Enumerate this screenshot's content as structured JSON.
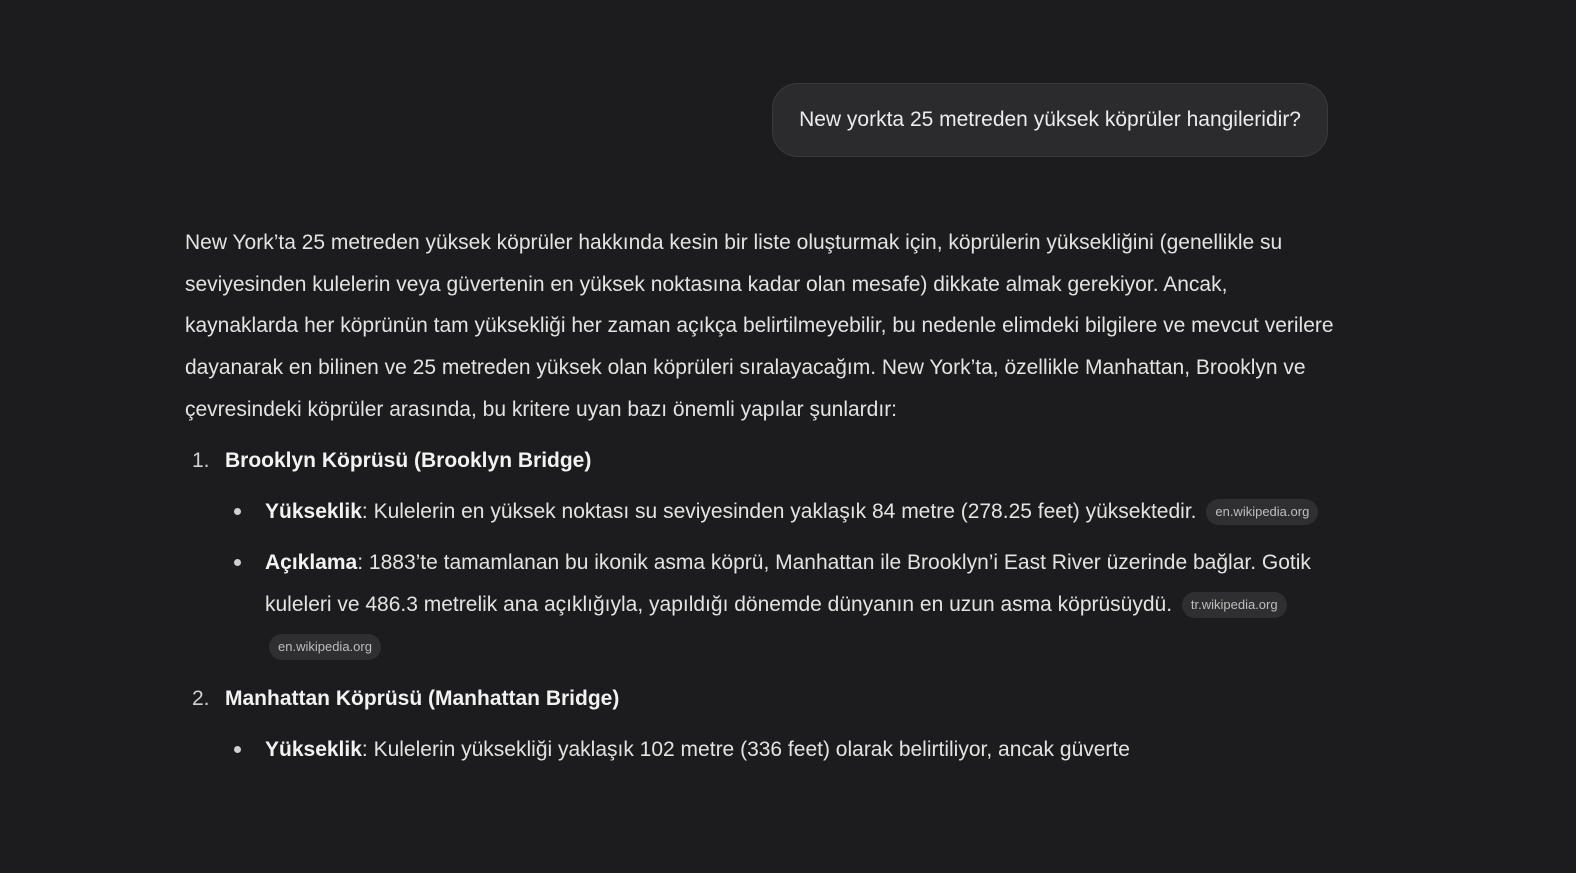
{
  "user_message": "New yorkta 25 metreden yüksek köprüler hangileridir?",
  "answer": {
    "intro": "New York’ta 25 metreden yüksek köprüler hakkında kesin bir liste oluşturmak için, köprülerin yüksekliğini (genellikle su seviyesinden kulelerin veya güvertenin en yüksek noktasına kadar olan mesafe) dikkate almak gerekiyor. Ancak, kaynaklarda her köprünün tam yüksekliği her zaman açıkça belirtilmeyebilir, bu nedenle elimdeki bilgilere ve mevcut verilere dayanarak en bilinen ve 25 metreden yüksek olan köprüleri sıralayacağım. New York’ta, özellikle Manhattan, Brooklyn ve çevresindeki köprüler arasında, bu kritere uyan bazı önemli yapılar şunlardır:",
    "items": [
      {
        "number": "1.",
        "title": "Brooklyn Köprüsü (Brooklyn Bridge)",
        "bullets": [
          {
            "label": "Yükseklik",
            "text": ": Kulelerin en yüksek noktası su seviyesinden yaklaşık 84 metre (278.25 feet) yüksektedir.",
            "sources": [
              "en.wikipedia.org"
            ]
          },
          {
            "label": "Açıklama",
            "text": ": 1883’te tamamlanan bu ikonik asma köprü, Manhattan ile Brooklyn’i East River üzerinde bağlar. Gotik kuleleri ve 486.3 metrelik ana açıklığıyla, yapıldığı dönemde dünyanın en uzun asma köprüsüydü.",
            "sources": [
              "tr.wikipedia.org",
              "en.wikipedia.org"
            ]
          }
        ]
      },
      {
        "number": "2.",
        "title": "Manhattan Köprüsü (Manhattan Bridge)",
        "bullets": [
          {
            "label": "Yükseklik",
            "text": ": Kulelerin yüksekliği yaklaşık 102 metre (336 feet) olarak belirtiliyor, ancak güverte",
            "sources": []
          }
        ]
      }
    ]
  }
}
